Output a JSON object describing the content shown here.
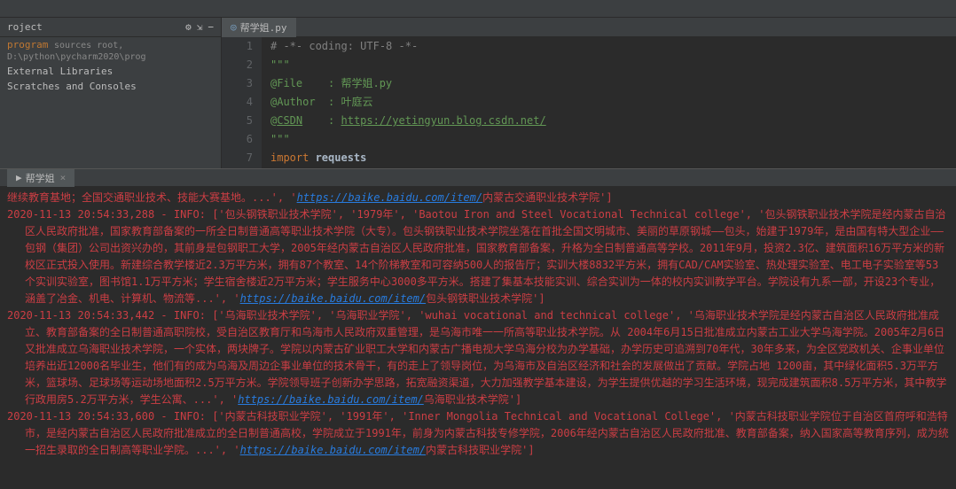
{
  "topbar": {
    "breadcrumb": ""
  },
  "sidebar": {
    "header_label": "roject",
    "items": {
      "root_label": "program",
      "root_hint": "sources root, D:\\python\\pycharm2020\\prog",
      "ext_lib": "External Libraries",
      "scratches": "Scratches and Consoles"
    }
  },
  "tabs": {
    "editor_tab": "帮学姐.py"
  },
  "code": {
    "l1": "# -*- coding: UTF-8 -*-",
    "l2": "\"\"\"",
    "l3_a": "@File    : ",
    "l3_b": "帮学姐.py",
    "l4_a": "@Author  : ",
    "l4_b": "叶庭云",
    "l5_a": "@",
    "l5_csdn": "CSDN",
    "l5_b": "    : ",
    "l5_link": "https://yetingyun.blog.csdn.net/",
    "l6": "\"\"\"",
    "l7_kw": "import",
    "l7_mod": " requests"
  },
  "console": {
    "tab_label": "帮学姐",
    "lines": [
      {
        "a": "继续教育基地；全国交通职业技术、技能大赛基地。...', '",
        "link": "https://baike.baidu.com/item/",
        "b": "内蒙古交通职业技术学院']"
      },
      {
        "a": "2020-11-13 20:54:33,288 - INFO: ['包头钢铁职业技术学院', '1979年', 'Baotou Iron and Steel Vocational Technical college', '包头钢铁职业技术学院是经内蒙古自治区人民政府批准，国家教育部备案的一所全日制普通高等职业技术学院（大专）。包头钢铁职业技术学院坐落在首批全国文明城市、美丽的草原钢城——包头，始建于1979年，是由国有特大型企业——包钢（集团）公司出资兴办的，其前身是包钢职工大学，2005年经内蒙古自治区人民政府批准，国家教育部备案，升格为全日制普通高等学校。2011年9月，投资2.3亿、建筑面积16万平方米的新校区正式投入使用。新建综合教学楼近2.3万平方米，拥有87个教室、14个阶梯教室和可容纳500人的报告厅；实训大楼8832平方米，拥有CAD/CAM实验室、热处理实验室、电工电子实验室等53个实训实验室，图书馆1.1万平方米；学生宿舍楼近2万平方米；学生服务中心3000多平方米。搭建了集基本技能实训、综合实训为一体的校内实训教学平台。学院设有九系一部，开设23个专业，涵盖了冶金、机电、计算机、物流等...', '",
        "link": "https://baike.baidu.com/item/",
        "b": "包头钢铁职业技术学院']"
      },
      {
        "a": "2020-11-13 20:54:33,442 - INFO: ['乌海职业技术学院', '乌海职业学院', 'wuhai vocational and technical college', '乌海职业技术学院是经内蒙古自治区人民政府批准成立、教育部备案的全日制普通高职院校，受自治区教育厅和乌海市人民政府双重管理，是乌海市唯一一所高等职业技术学院。从 2004年6月15日批准成立内蒙古工业大学乌海学院。2005年2月6日又批准成立乌海职业技术学院，一个实体，两块牌子。学院以内蒙古矿业职工大学和内蒙古广播电视大学乌海分校为办学基础，办学历史可追溯到70年代，30年多来，为全区党政机关、企事业单位培养出近12000名毕业生，他们有的成为乌海及周边企事业单位的技术骨干，有的走上了领导岗位，为乌海市及自治区经济和社会的发展做出了贡献。学院占地 1200亩，其中绿化面积5.3万平方米，篮球场、足球场等运动场地面积2.5万平方米。学院领导班子创新办学思路，拓宽融资渠道，大力加强教学基本建设，为学生提供优越的学习生活环境，现完成建筑面积8.5万平方米，其中教学行政用房5.2万平方米，学生公寓、...', '",
        "link": "https://baike.baidu.com/item/",
        "b": "乌海职业技术学院']"
      },
      {
        "a": "2020-11-13 20:54:33,600 - INFO: ['内蒙古科技职业学院', '1991年', 'Inner Mongolia Technical and Vocational College', '内蒙古科技职业学院位于自治区首府呼和浩特市，是经内蒙古自治区人民政府批准成立的全日制普通高校，学院成立于1991年，前身为内蒙古科技专修学院，2006年经内蒙古自治区人民政府批准、教育部备案，纳入国家高等教育序列，成为统一招生录取的全日制高等职业学院。...', '",
        "link": "https://baike.baidu.com/item/",
        "b": "内蒙古科技职业学院']"
      }
    ]
  },
  "linenums": [
    "1",
    "2",
    "3",
    "4",
    "5",
    "6",
    "7"
  ]
}
